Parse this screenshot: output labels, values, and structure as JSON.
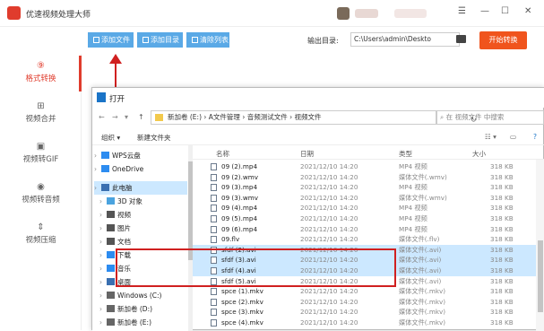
{
  "app": {
    "title": "优速视频处理大师",
    "minimize": "—",
    "maximize": "☐",
    "close": "✕",
    "menu": "☰"
  },
  "toolbar": {
    "add_file": "添加文件",
    "add_dir": "添加目录",
    "clear_list": "清除列表",
    "output_label": "输出目录:",
    "output_path": "C:\\Users\\admin\\Deskto",
    "browse": "...",
    "start": "开始转换"
  },
  "sidebar": [
    {
      "label": "格式转换",
      "icon": "format-convert-icon",
      "glyph": "⑨",
      "active": true
    },
    {
      "label": "视频合并",
      "icon": "merge-icon",
      "glyph": "⊞"
    },
    {
      "label": "视频转GIF",
      "icon": "gif-icon",
      "glyph": "▣"
    },
    {
      "label": "视频转音频",
      "icon": "audio-icon",
      "glyph": "◉"
    },
    {
      "label": "视频压缩",
      "icon": "compress-icon",
      "glyph": "⇕"
    }
  ],
  "dialog": {
    "title": "打开",
    "address": [
      "新加卷 (E:)",
      "A文件管理",
      "音频测试文件",
      "视频文件"
    ],
    "search_placeholder": "在 视频文件 中搜索",
    "organize": "组织 ▾",
    "new_folder": "新建文件夹",
    "nav": [
      {
        "label": "WPS云盘",
        "color": "#2d8cf0"
      },
      {
        "label": "OneDrive",
        "color": "#2d8cf0"
      },
      {
        "label": "此电脑",
        "color": "#3a6fb0",
        "selected": true
      },
      {
        "label": "3D 对象",
        "color": "#4aa3df"
      },
      {
        "label": "视频",
        "color": "#555"
      },
      {
        "label": "图片",
        "color": "#555"
      },
      {
        "label": "文档",
        "color": "#555"
      },
      {
        "label": "下载",
        "color": "#2d8cf0"
      },
      {
        "label": "音乐",
        "color": "#2d8cf0"
      },
      {
        "label": "桌面",
        "color": "#3a6fb0"
      },
      {
        "label": "Windows (C:)",
        "color": "#666"
      },
      {
        "label": "新加卷 (D:)",
        "color": "#666"
      },
      {
        "label": "新加卷 (E:)",
        "color": "#666"
      }
    ],
    "columns": {
      "name": "名称",
      "date": "日期",
      "type": "类型",
      "size": "大小"
    },
    "files": [
      {
        "name": "09 (2).mp4",
        "date": "2021/12/10 14:20",
        "type": "MP4 视频",
        "size": "318 KB"
      },
      {
        "name": "09 (2).wmv",
        "date": "2021/12/10 14:20",
        "type": "媒体文件(.wmv)",
        "size": "318 KB"
      },
      {
        "name": "09 (3).mp4",
        "date": "2021/12/10 14:20",
        "type": "MP4 视频",
        "size": "318 KB"
      },
      {
        "name": "09 (3).wmv",
        "date": "2021/12/10 14:20",
        "type": "媒体文件(.wmv)",
        "size": "318 KB"
      },
      {
        "name": "09 (4).mp4",
        "date": "2021/12/10 14:20",
        "type": "MP4 视频",
        "size": "318 KB"
      },
      {
        "name": "09 (5).mp4",
        "date": "2021/12/10 14:20",
        "type": "MP4 视频",
        "size": "318 KB"
      },
      {
        "name": "09 (6).mp4",
        "date": "2021/12/10 14:20",
        "type": "MP4 视频",
        "size": "318 KB"
      },
      {
        "name": "09.flv",
        "date": "2021/12/10 14:20",
        "type": "媒体文件(.flv)",
        "size": "318 KB"
      },
      {
        "name": "sfdf (2).avi",
        "date": "2021/12/10 14:20",
        "type": "媒体文件(.avi)",
        "size": "318 KB",
        "selected": true
      },
      {
        "name": "sfdf (3).avi",
        "date": "2021/12/10 14:20",
        "type": "媒体文件(.avi)",
        "size": "318 KB",
        "selected": true
      },
      {
        "name": "sfdf (4).avi",
        "date": "2021/12/10 14:20",
        "type": "媒体文件(.avi)",
        "size": "318 KB",
        "selected": true
      },
      {
        "name": "sfdf (5).avi",
        "date": "2021/12/10 14:20",
        "type": "媒体文件(.avi)",
        "size": "318 KB"
      },
      {
        "name": "spce (1).mkv",
        "date": "2021/12/10 14:20",
        "type": "媒体文件(.mkv)",
        "size": "318 KB"
      },
      {
        "name": "spce (2).mkv",
        "date": "2021/12/10 14:20",
        "type": "媒体文件(.mkv)",
        "size": "318 KB"
      },
      {
        "name": "spce (3).mkv",
        "date": "2021/12/10 14:20",
        "type": "媒体文件(.mkv)",
        "size": "318 KB"
      },
      {
        "name": "spce (4).mkv",
        "date": "2021/12/10 14:20",
        "type": "媒体文件(.mkv)",
        "size": "318 KB"
      }
    ]
  },
  "colors": {
    "accent": "#e03c2d",
    "toolbar_button": "#5aa9e6",
    "start_button": "#f0541d",
    "selection": "#cce8ff",
    "highlight_box": "#d02020"
  }
}
